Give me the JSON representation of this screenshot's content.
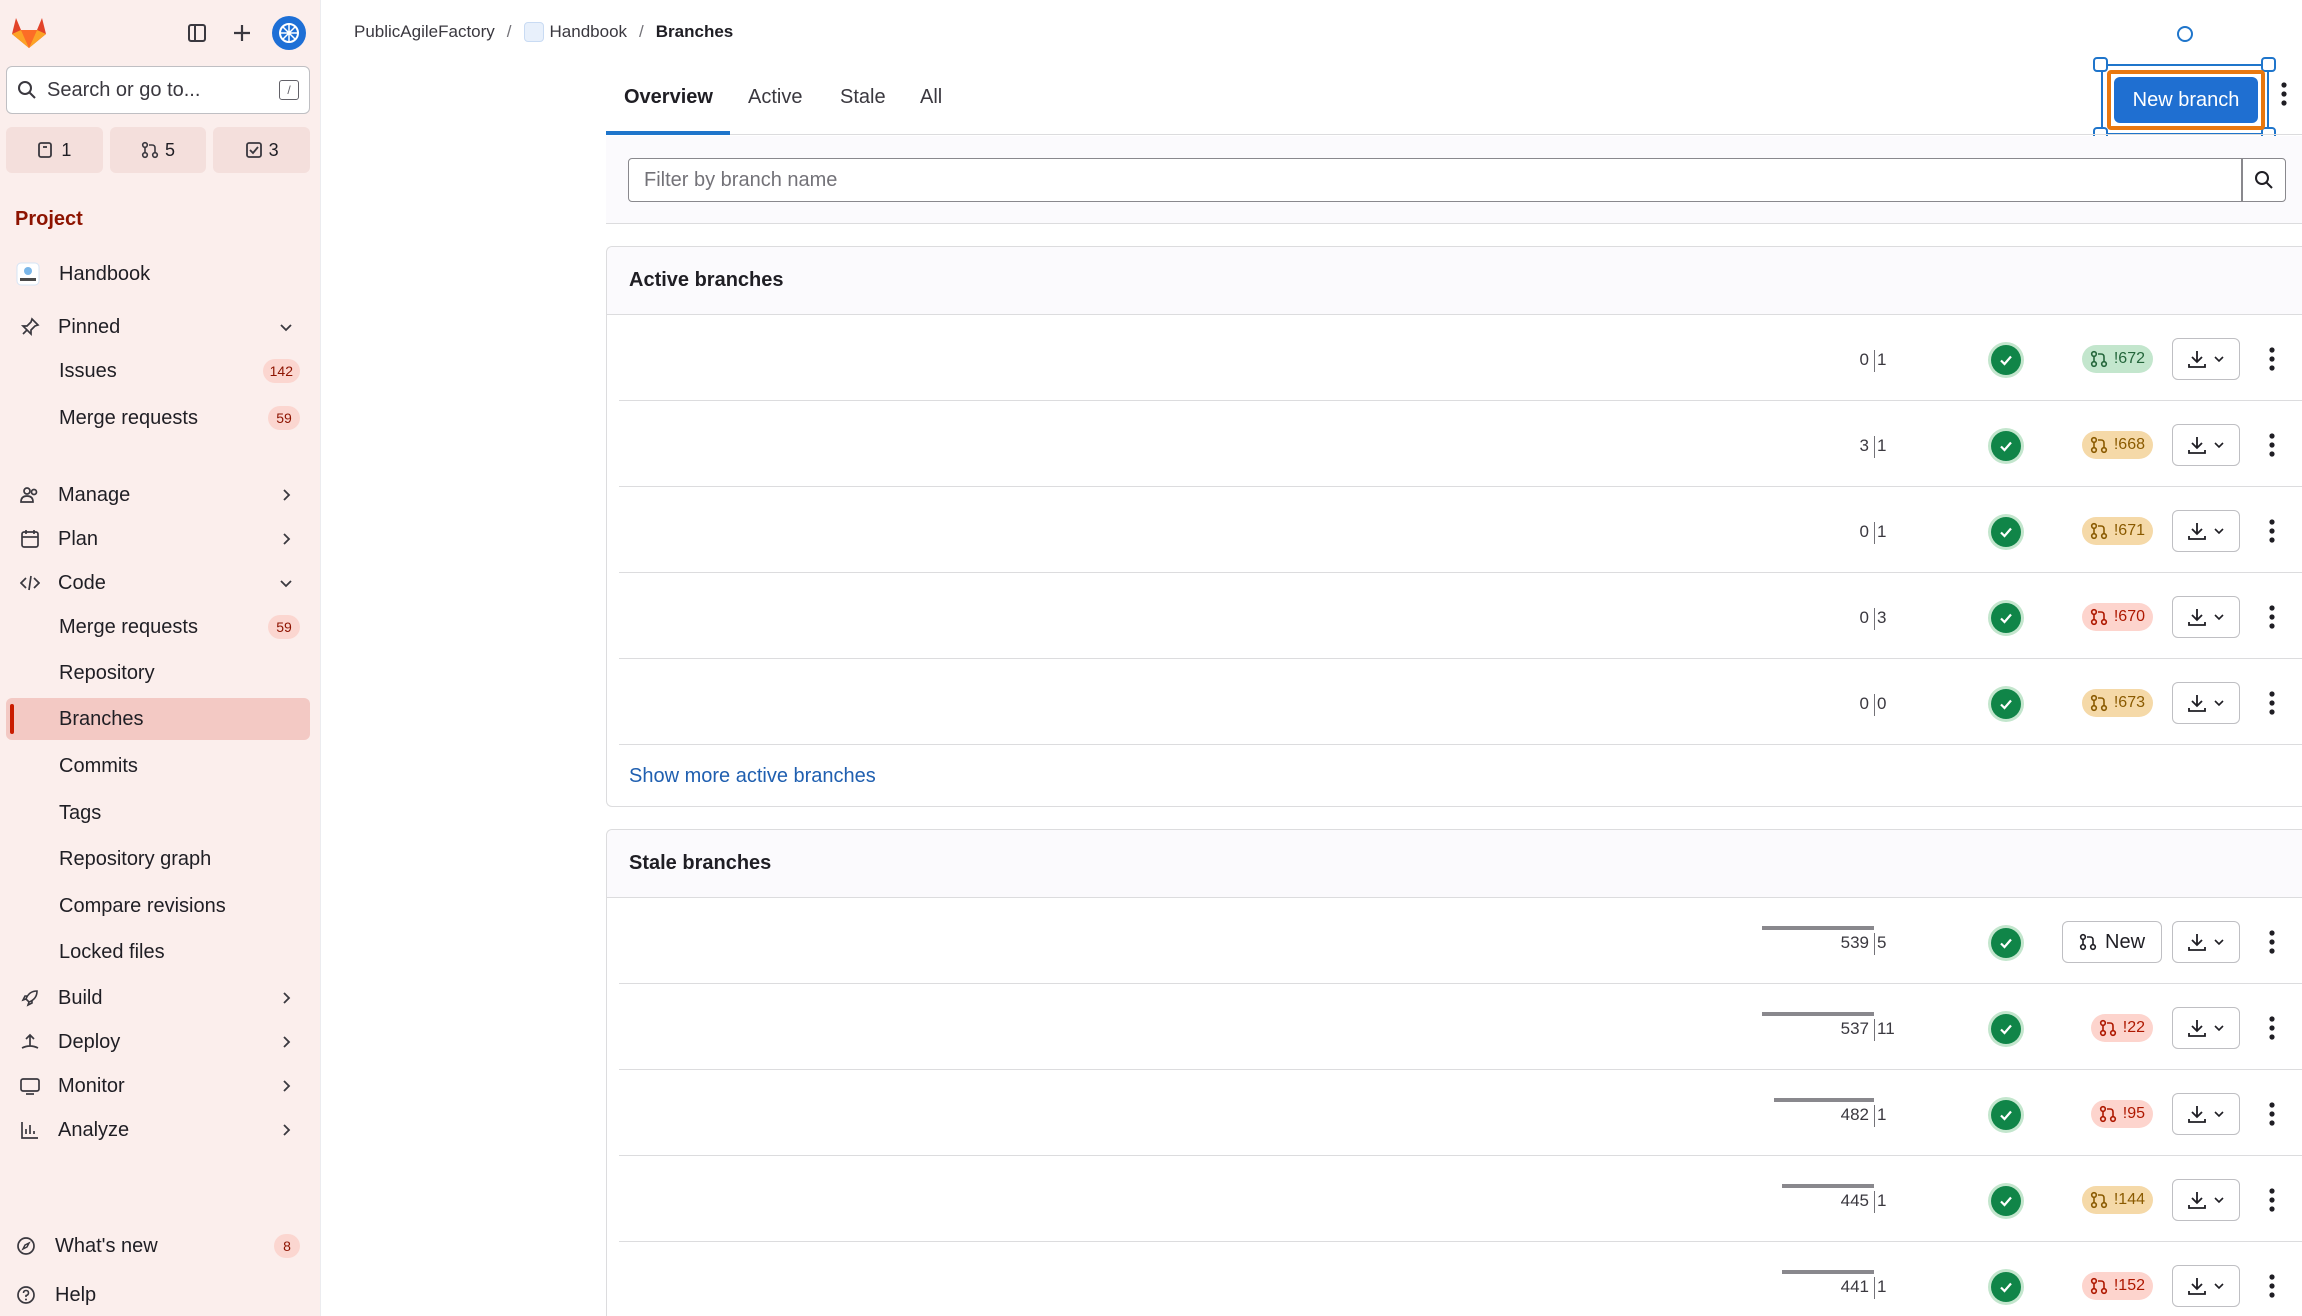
{
  "sidebar": {
    "search_placeholder": "Search or go to...",
    "search_shortcut": "/",
    "counts": {
      "issues": "1",
      "merge_requests": "5",
      "todos": "3"
    },
    "section_title": "Project",
    "project_name": "Handbook",
    "pinned_label": "Pinned",
    "pinned_items": [
      {
        "label": "Issues",
        "badge": "142"
      },
      {
        "label": "Merge requests",
        "badge": "59"
      }
    ],
    "groups": {
      "manage": "Manage",
      "plan": "Plan",
      "code": "Code",
      "build": "Build",
      "deploy": "Deploy",
      "monitor": "Monitor",
      "analyze": "Analyze"
    },
    "code_items": [
      {
        "label": "Merge requests",
        "badge": "59"
      },
      {
        "label": "Repository"
      },
      {
        "label": "Branches"
      },
      {
        "label": "Commits"
      },
      {
        "label": "Tags"
      },
      {
        "label": "Repository graph"
      },
      {
        "label": "Compare revisions"
      },
      {
        "label": "Locked files"
      }
    ],
    "whats_new": {
      "label": "What's new",
      "badge": "8"
    },
    "help": "Help"
  },
  "breadcrumb": {
    "group": "PublicAgileFactory",
    "project": "Handbook",
    "current": "Branches"
  },
  "tabs": [
    "Overview",
    "Active",
    "Stale",
    "All"
  ],
  "new_branch_label": "New branch",
  "filter_placeholder": "Filter by branch name",
  "active": {
    "title": "Active branches",
    "rows": [
      {
        "behind": "0",
        "ahead": "1",
        "mr": "!672",
        "mr_state": "green"
      },
      {
        "behind": "3",
        "ahead": "1",
        "mr": "!668",
        "mr_state": "orange"
      },
      {
        "behind": "0",
        "ahead": "1",
        "mr": "!671",
        "mr_state": "orange"
      },
      {
        "behind": "0",
        "ahead": "3",
        "mr": "!670",
        "mr_state": "red"
      },
      {
        "behind": "0",
        "ahead": "0",
        "mr": "!673",
        "mr_state": "orange"
      }
    ],
    "more_link": "Show more active branches"
  },
  "stale": {
    "title": "Stale branches",
    "rows": [
      {
        "behind": "539",
        "ahead": "5",
        "mr": "New",
        "mr_state": "new"
      },
      {
        "behind": "537",
        "ahead": "11",
        "mr": "!22",
        "mr_state": "red"
      },
      {
        "behind": "482",
        "ahead": "1",
        "mr": "!95",
        "mr_state": "red"
      },
      {
        "behind": "445",
        "ahead": "1",
        "mr": "!144",
        "mr_state": "orange"
      },
      {
        "behind": "441",
        "ahead": "1",
        "mr": "!152",
        "mr_state": "red"
      }
    ]
  },
  "colors": {
    "brand_blue": "#1f6fd1",
    "sidebar_bg": "#fbeeec",
    "highlight_orange": "#e9780f"
  }
}
